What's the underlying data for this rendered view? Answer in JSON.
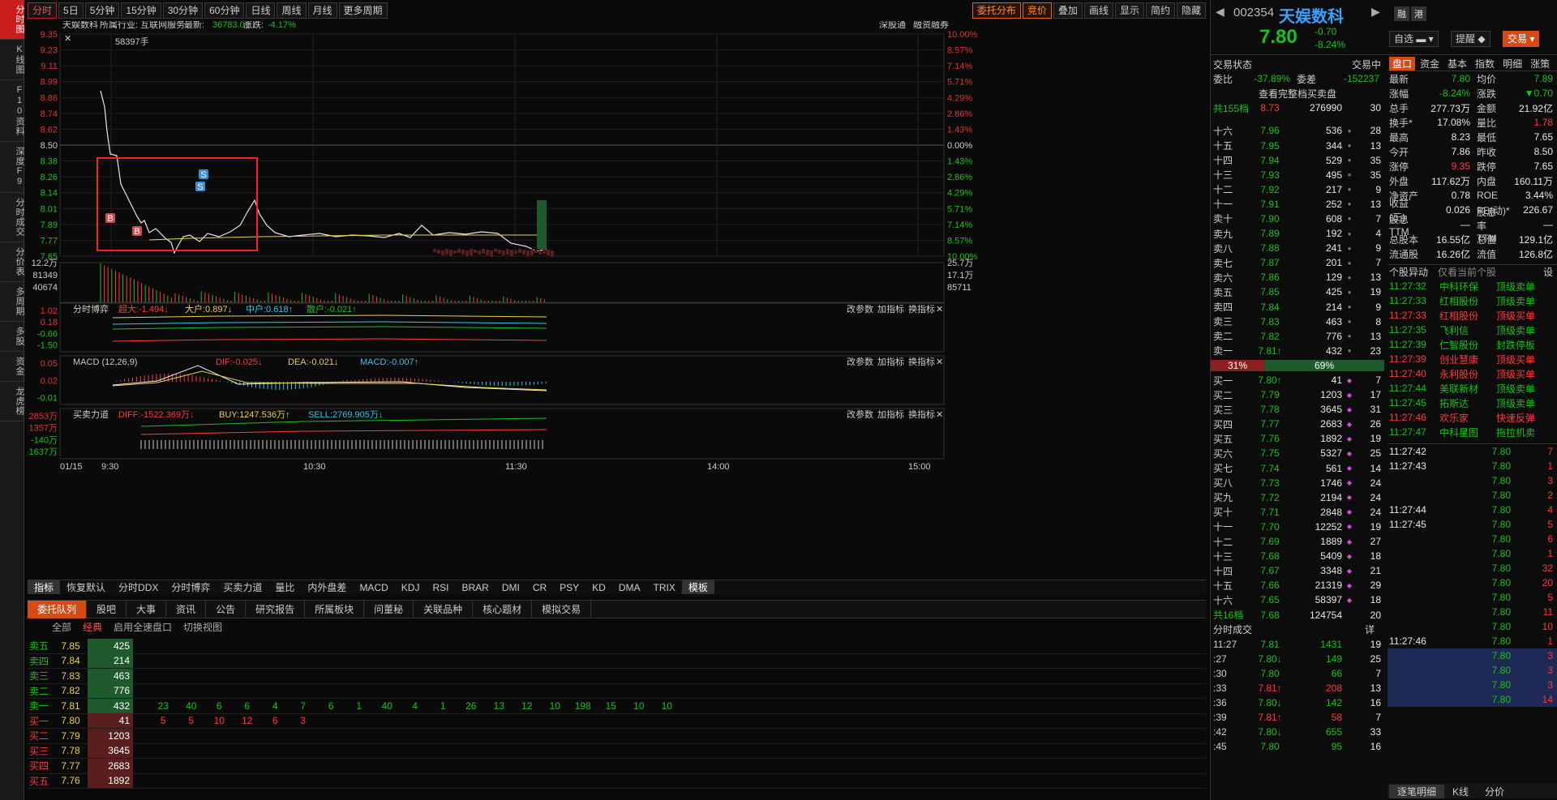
{
  "sidebar": [
    "分时图",
    "K线图",
    "F10资料",
    "深度F9",
    "分时成交",
    "分价表",
    "多周期",
    "多股",
    "资金",
    "龙虎榜"
  ],
  "topbar": {
    "periods": [
      "分时",
      "5日",
      "5分钟",
      "15分钟",
      "30分钟",
      "60分钟",
      "日线",
      "周线",
      "月线",
      "更多周期"
    ],
    "right": [
      "委托分布",
      "竞价",
      "叠加",
      "画线",
      "显示",
      "简约",
      "隐藏"
    ]
  },
  "chart": {
    "header": {
      "name": "天娱数科",
      "industry": "所属行业: 互联网服务",
      "latest_label": "最新:",
      "latest": "36783.01",
      "chg_label": "涨跌:",
      "chg": "-4.17%",
      "links": [
        "深股通",
        "融资融券"
      ]
    },
    "vol_tip": "58397手",
    "price_ticks": [
      "9.35",
      "9.23",
      "9.11",
      "8.99",
      "8.86",
      "8.74",
      "8.62",
      "8.50",
      "8.38",
      "8.26",
      "8.14",
      "8.01",
      "7.89",
      "7.77",
      "7.65"
    ],
    "pct_ticks": [
      "10.00%",
      "8.57%",
      "7.14%",
      "5.71%",
      "4.29%",
      "2.86%",
      "1.43%",
      "0.00%",
      "1.43%",
      "2.86%",
      "4.29%",
      "5.71%",
      "7.14%",
      "8.57%",
      "10.00%"
    ],
    "vol_ticks": [
      "12.2万",
      "81349",
      "40674"
    ],
    "vol_right": [
      "25.7万",
      "17.1万",
      "85711"
    ],
    "time_ticks": [
      "01/15",
      "9:30",
      "10:30",
      "11:30",
      "14:00",
      "15:00"
    ],
    "panel1": {
      "title": "分时博弈",
      "a": "超大:-1.494↓",
      "b": "大户:0.897↓",
      "c": "中户:0.618↑",
      "d": "散户:-0.021↑",
      "ticks": [
        "1.02",
        "0.18",
        "-0.66",
        "-1.50"
      ]
    },
    "panel2": {
      "title": "MACD (12,26,9)",
      "a": "DIF:-0.025↓",
      "b": "DEA:-0.021↓",
      "c": "MACD:-0.007↑",
      "ticks": [
        "0.05",
        "0.02",
        "-0.01"
      ]
    },
    "panel3": {
      "title": "买卖力道",
      "a": "DIFF:-1522.369万↓",
      "b": "BUY:1247.536万↑",
      "c": "SELL:2769.905万↓",
      "ticks": [
        "2853万",
        "1357万",
        "-140万",
        "-1637万"
      ]
    },
    "panel_btns": [
      "改参数",
      "加指标",
      "换指标"
    ]
  },
  "indtabs": [
    "指标",
    "恢复默认",
    "分时DDX",
    "分时博弈",
    "买卖力道",
    "量比",
    "内外盘差",
    "MACD",
    "KDJ",
    "RSI",
    "BRAR",
    "DMI",
    "CR",
    "PSY",
    "KD",
    "DMA",
    "TRIX",
    "模板"
  ],
  "bottom": {
    "tabs": [
      "委托队列",
      "股吧",
      "大事",
      "资讯",
      "公告",
      "研究报告",
      "所属板块",
      "问董秘",
      "关联品种",
      "核心题材",
      "模拟交易"
    ],
    "sub": [
      "全部",
      "经典",
      "启用全速盘口",
      "切换视图"
    ],
    "rows": [
      {
        "l": "卖五",
        "p": "7.85",
        "v": "425",
        "t": "s",
        "o": []
      },
      {
        "l": "卖四",
        "p": "7.84",
        "v": "214",
        "t": "s",
        "o": []
      },
      {
        "l": "卖三",
        "p": "7.83",
        "v": "463",
        "t": "s",
        "o": []
      },
      {
        "l": "卖二",
        "p": "7.82",
        "v": "776",
        "t": "s",
        "o": []
      },
      {
        "l": "卖一",
        "p": "7.81",
        "v": "432",
        "t": "s",
        "o": [
          "23",
          "40",
          "6",
          "6",
          "4",
          "7",
          "6",
          "1",
          "40",
          "4",
          "1",
          "26",
          "13",
          "12",
          "10",
          "198",
          "15",
          "10",
          "10"
        ]
      },
      {
        "l": "买一",
        "p": "7.80",
        "v": "41",
        "t": "b",
        "o": [
          "5",
          "5",
          "10",
          "12",
          "6",
          "3"
        ]
      },
      {
        "l": "买二",
        "p": "7.79",
        "v": "1203",
        "t": "b",
        "o": []
      },
      {
        "l": "买三",
        "p": "7.78",
        "v": "3645",
        "t": "b",
        "o": []
      },
      {
        "l": "买四",
        "p": "7.77",
        "v": "2683",
        "t": "b",
        "o": []
      },
      {
        "l": "买五",
        "p": "7.76",
        "v": "1892",
        "t": "b",
        "o": []
      }
    ]
  },
  "stock": {
    "code": "002354",
    "name": "天娱数科",
    "price": "7.80",
    "chg": "-0.70",
    "pct": "-8.24%",
    "tags": [
      "融",
      "港"
    ],
    "btns": [
      "自选",
      "提醒",
      "交易"
    ]
  },
  "orderbook": {
    "status_l": "交易状态",
    "status_r": "交易中",
    "wb_l": "委比",
    "wb": "-37.89%",
    "wc_l": "委差",
    "wc": "-152237",
    "full": "查看完整档买卖盘",
    "top_l": "共155档",
    "top_p": "8.73",
    "top_v": "276990",
    "top_n": "30",
    "sells": [
      [
        "十六",
        "7.96",
        "536",
        "28"
      ],
      [
        "十五",
        "7.95",
        "344",
        "13"
      ],
      [
        "十四",
        "7.94",
        "529",
        "35"
      ],
      [
        "十三",
        "7.93",
        "495",
        "35"
      ],
      [
        "十二",
        "7.92",
        "217",
        "9"
      ],
      [
        "十一",
        "7.91",
        "252",
        "13"
      ],
      [
        "卖十",
        "7.90",
        "608",
        "7"
      ],
      [
        "卖九",
        "7.89",
        "192",
        "4"
      ],
      [
        "卖八",
        "7.88",
        "241",
        "9"
      ],
      [
        "卖七",
        "7.87",
        "201",
        "7"
      ],
      [
        "卖六",
        "7.86",
        "129",
        "13"
      ],
      [
        "卖五",
        "7.85",
        "425",
        "19"
      ],
      [
        "卖四",
        "7.84",
        "214",
        "9"
      ],
      [
        "卖三",
        "7.83",
        "463",
        "8"
      ],
      [
        "卖二",
        "7.82",
        "776",
        "13"
      ],
      [
        "卖一",
        "7.81↑",
        "432",
        "23"
      ]
    ],
    "ratio_b": "31%",
    "ratio_s": "69%",
    "buys": [
      [
        "买一",
        "7.80↑",
        "41",
        "7"
      ],
      [
        "买二",
        "7.79",
        "1203",
        "17"
      ],
      [
        "买三",
        "7.78",
        "3645",
        "31"
      ],
      [
        "买四",
        "7.77",
        "2683",
        "26"
      ],
      [
        "买五",
        "7.76",
        "1892",
        "19"
      ],
      [
        "买六",
        "7.75",
        "5327",
        "25"
      ],
      [
        "买七",
        "7.74",
        "561",
        "14"
      ],
      [
        "买八",
        "7.73",
        "1746",
        "24"
      ],
      [
        "买九",
        "7.72",
        "2194",
        "24"
      ],
      [
        "买十",
        "7.71",
        "2848",
        "24"
      ],
      [
        "十一",
        "7.70",
        "12252",
        "19"
      ],
      [
        "十二",
        "7.69",
        "1889",
        "27"
      ],
      [
        "十三",
        "7.68",
        "5409",
        "18"
      ],
      [
        "十四",
        "7.67",
        "3348",
        "21"
      ],
      [
        "十五",
        "7.66",
        "21319",
        "29"
      ],
      [
        "十六",
        "7.65",
        "58397",
        "18"
      ]
    ],
    "bot_l": "共16档",
    "bot_p": "7.68",
    "bot_v": "124754",
    "bot_n": "20"
  },
  "ticks_title": "分时成交",
  "ticks_more": "详",
  "ticks": [
    [
      "11:27",
      "7.81",
      "1431",
      "19"
    ],
    [
      ":27",
      "7.80↓",
      "149",
      "25"
    ],
    [
      ":30",
      "7.80",
      "66",
      "7"
    ],
    [
      ":33",
      "7.81↑",
      "208",
      "13"
    ],
    [
      ":36",
      "7.80↓",
      "142",
      "16"
    ],
    [
      ":39",
      "7.81↑",
      "58",
      "7"
    ],
    [
      ":42",
      "7.80↓",
      "655",
      "33"
    ],
    [
      ":45",
      "7.80",
      "95",
      "16"
    ]
  ],
  "quote": {
    "tabs": [
      "盘口",
      "资金",
      "基本",
      "指数",
      "明细",
      "涨策"
    ],
    "rows": [
      [
        "最新",
        "7.80",
        "均价",
        "7.89"
      ],
      [
        "涨幅",
        "-8.24%",
        "涨跌",
        "▼0.70"
      ],
      [
        "总手",
        "277.73万",
        "金额",
        "21.92亿"
      ],
      [
        "换手*",
        "17.08%",
        "量比",
        "1.78"
      ],
      [
        "最高",
        "8.23",
        "最低",
        "7.65"
      ],
      [
        "今开",
        "7.86",
        "昨收",
        "8.50"
      ],
      [
        "涨停",
        "9.35",
        "跌停",
        "7.65"
      ],
      [
        "外盘",
        "117.62万",
        "内盘",
        "160.11万"
      ],
      [
        "净资产",
        "0.78",
        "ROE",
        "3.44%"
      ],
      [
        "收益(三)",
        "0.026",
        "PE(动)*",
        "226.67"
      ],
      [
        "股息TTM",
        "—",
        "股息率TTM",
        "—"
      ],
      [
        "总股本",
        "16.55亿",
        "总值",
        "129.1亿"
      ],
      [
        "流通股",
        "16.26亿",
        "流值",
        "126.8亿"
      ]
    ]
  },
  "anomaly": {
    "title": "个股异动",
    "opt": "仅看当前个股",
    "set": "设",
    "rows": [
      [
        "11:27:32",
        "中科环保",
        "顶级卖单"
      ],
      [
        "11:27:33",
        "红相股份",
        "顶级卖单"
      ],
      [
        "11:27:33",
        "红相股份",
        "顶级买单"
      ],
      [
        "11:27:35",
        "飞利信",
        "顶级卖单"
      ],
      [
        "11:27:39",
        "仁智股份",
        "封跌停板"
      ],
      [
        "11:27:39",
        "创业慧康",
        "顶级买单"
      ],
      [
        "11:27:40",
        "永利股份",
        "顶级买单"
      ],
      [
        "11:27:44",
        "美联新材",
        "顶级卖单"
      ],
      [
        "11:27:45",
        "拓斯达",
        "顶级卖单"
      ],
      [
        "11:27:46",
        "欢乐家",
        "快速反弹"
      ],
      [
        "11:27:47",
        "中科星图",
        "拖拉机卖"
      ]
    ]
  },
  "detail": [
    [
      "11:27:42",
      "7.80",
      "7"
    ],
    [
      "11:27:43",
      "7.80",
      "1"
    ],
    [
      "",
      "7.80",
      "3"
    ],
    [
      "",
      "7.80",
      "2"
    ],
    [
      "11:27:44",
      "7.80",
      "4"
    ],
    [
      "11:27:45",
      "7.80",
      "5"
    ],
    [
      "",
      "7.80",
      "6"
    ],
    [
      "",
      "7.80",
      "1"
    ],
    [
      "",
      "7.80",
      "32"
    ],
    [
      "",
      "7.80",
      "20"
    ],
    [
      "",
      "7.80",
      "5"
    ],
    [
      "",
      "7.80",
      "11"
    ],
    [
      "",
      "7.80",
      "10"
    ],
    [
      "11:27:46",
      "7.80",
      "1"
    ],
    [
      "",
      "7.80",
      "3"
    ],
    [
      "",
      "7.80",
      "3"
    ],
    [
      "",
      "7.80",
      "3"
    ],
    [
      "",
      "7.80",
      "14"
    ]
  ],
  "rp_bottom": [
    "逐笔明细",
    "K线",
    "分价"
  ]
}
